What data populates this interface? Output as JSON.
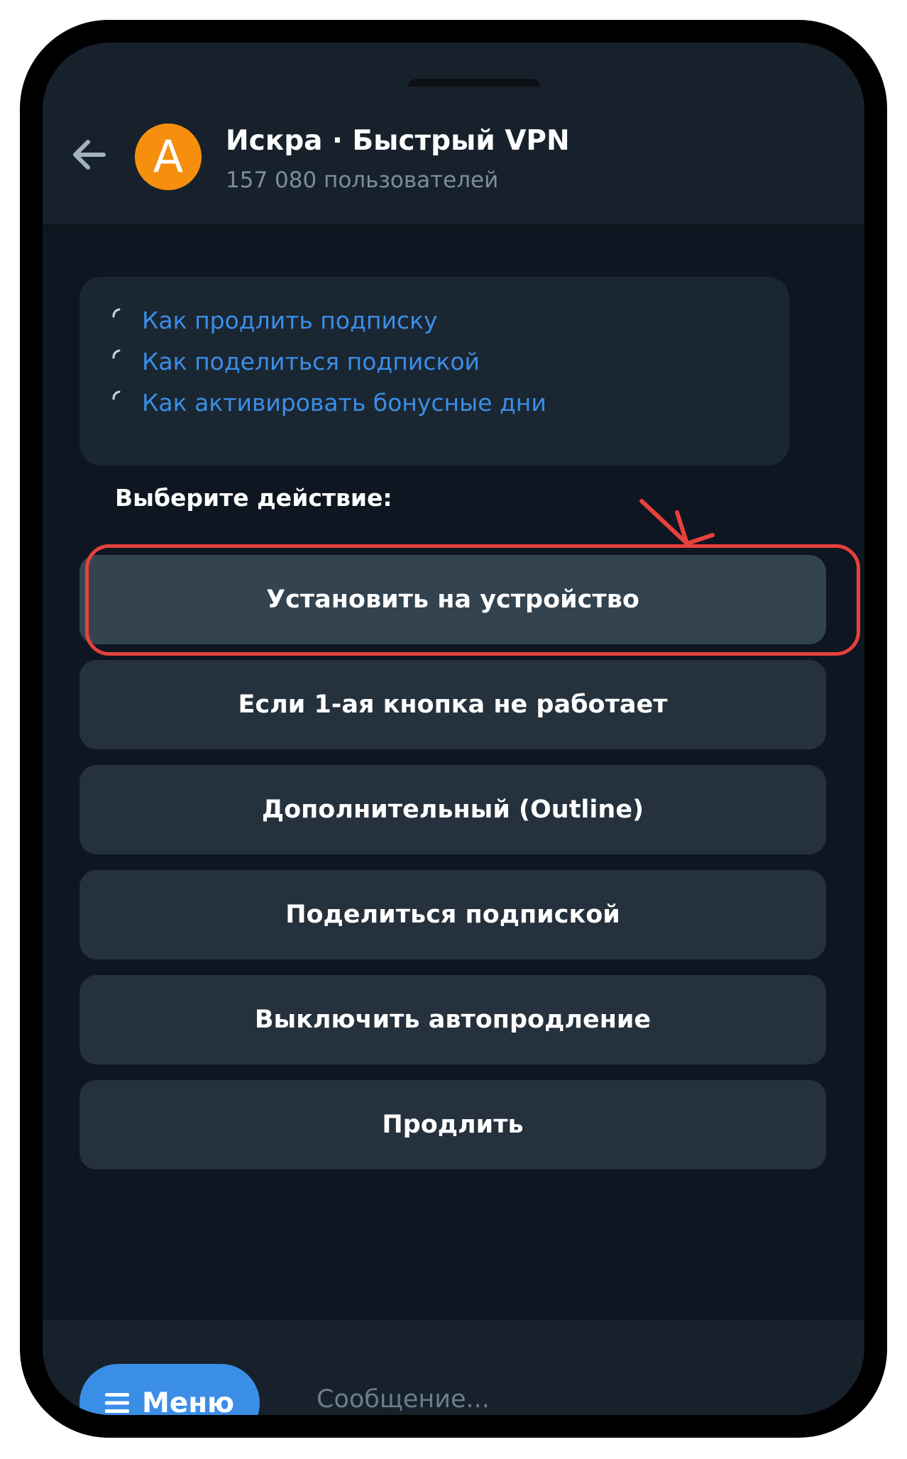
{
  "header": {
    "avatar_letter": "A",
    "title": "Искра · Быстрый VPN",
    "subtitle": "157 080 пользователей"
  },
  "links": [
    {
      "label": "Как продлить подписку"
    },
    {
      "label": "Как поделиться подпиской"
    },
    {
      "label": "Как активировать бонусные дни"
    }
  ],
  "prompt": "Выберите действие:",
  "buttons": [
    {
      "label": "Установить на устройство"
    },
    {
      "label": "Если 1-ая кнопка не работает"
    },
    {
      "label": "Дополнительный (Outline)"
    },
    {
      "label": "Поделиться подпиской"
    },
    {
      "label": "Выключить автопродление"
    },
    {
      "label": "Продлить"
    }
  ],
  "bottom": {
    "menu_label": "Меню",
    "input_placeholder": "Сообщение..."
  },
  "colors": {
    "accent": "#3a8ee6",
    "avatar": "#f68f0e",
    "highlight": "#e8413c",
    "background": "#0e1621",
    "button": "#25313d"
  }
}
